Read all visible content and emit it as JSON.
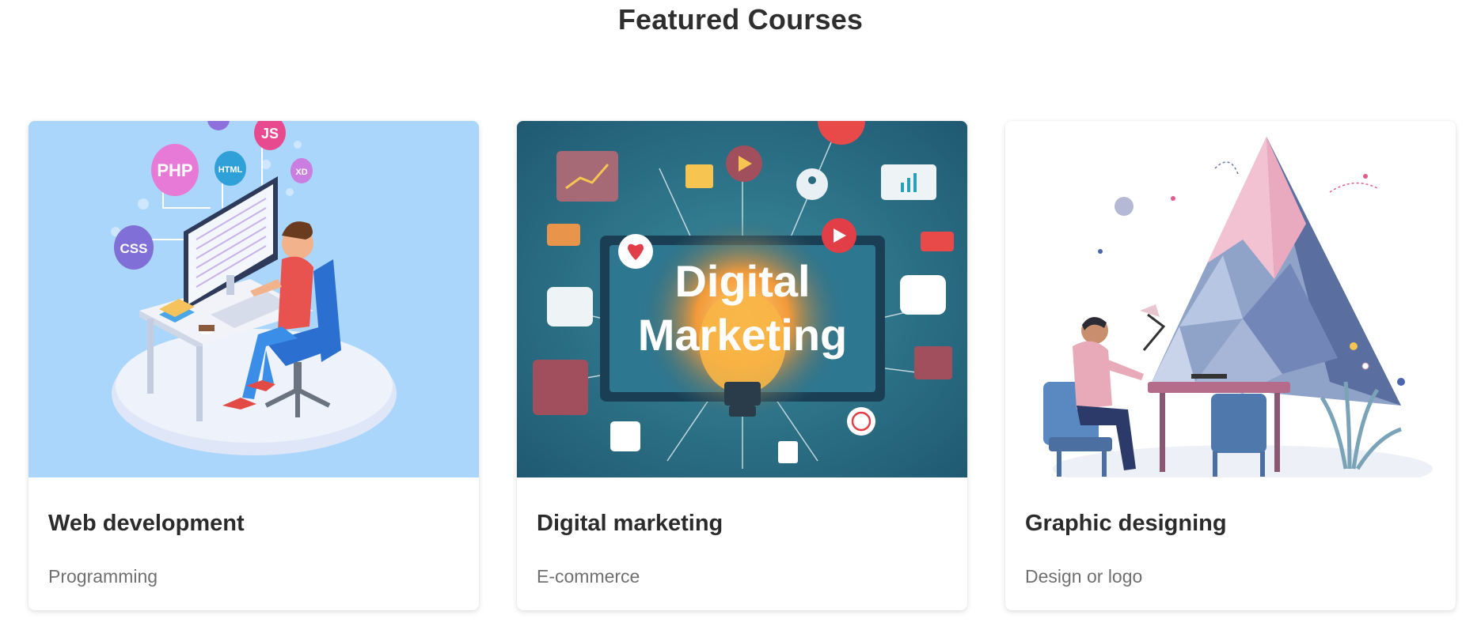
{
  "section": {
    "title": "Featured Courses"
  },
  "courses": [
    {
      "title": "Web development",
      "category": "Programming",
      "image": "web-development-illustration",
      "image_bg": "#a9d6fa",
      "image_labels": {
        "php": "PHP",
        "css": "CSS",
        "html": "HTML",
        "js": "JS",
        "xd": "XD"
      }
    },
    {
      "title": "Digital marketing",
      "category": "E-commerce",
      "image": "digital-marketing-illustration",
      "image_bg": "#2a7286",
      "image_labels": {
        "line1": "Digital",
        "line2": "Marketing"
      }
    },
    {
      "title": "Graphic designing",
      "category": "Design or logo",
      "image": "graphic-design-illustration",
      "image_bg": "#ffffff"
    }
  ]
}
